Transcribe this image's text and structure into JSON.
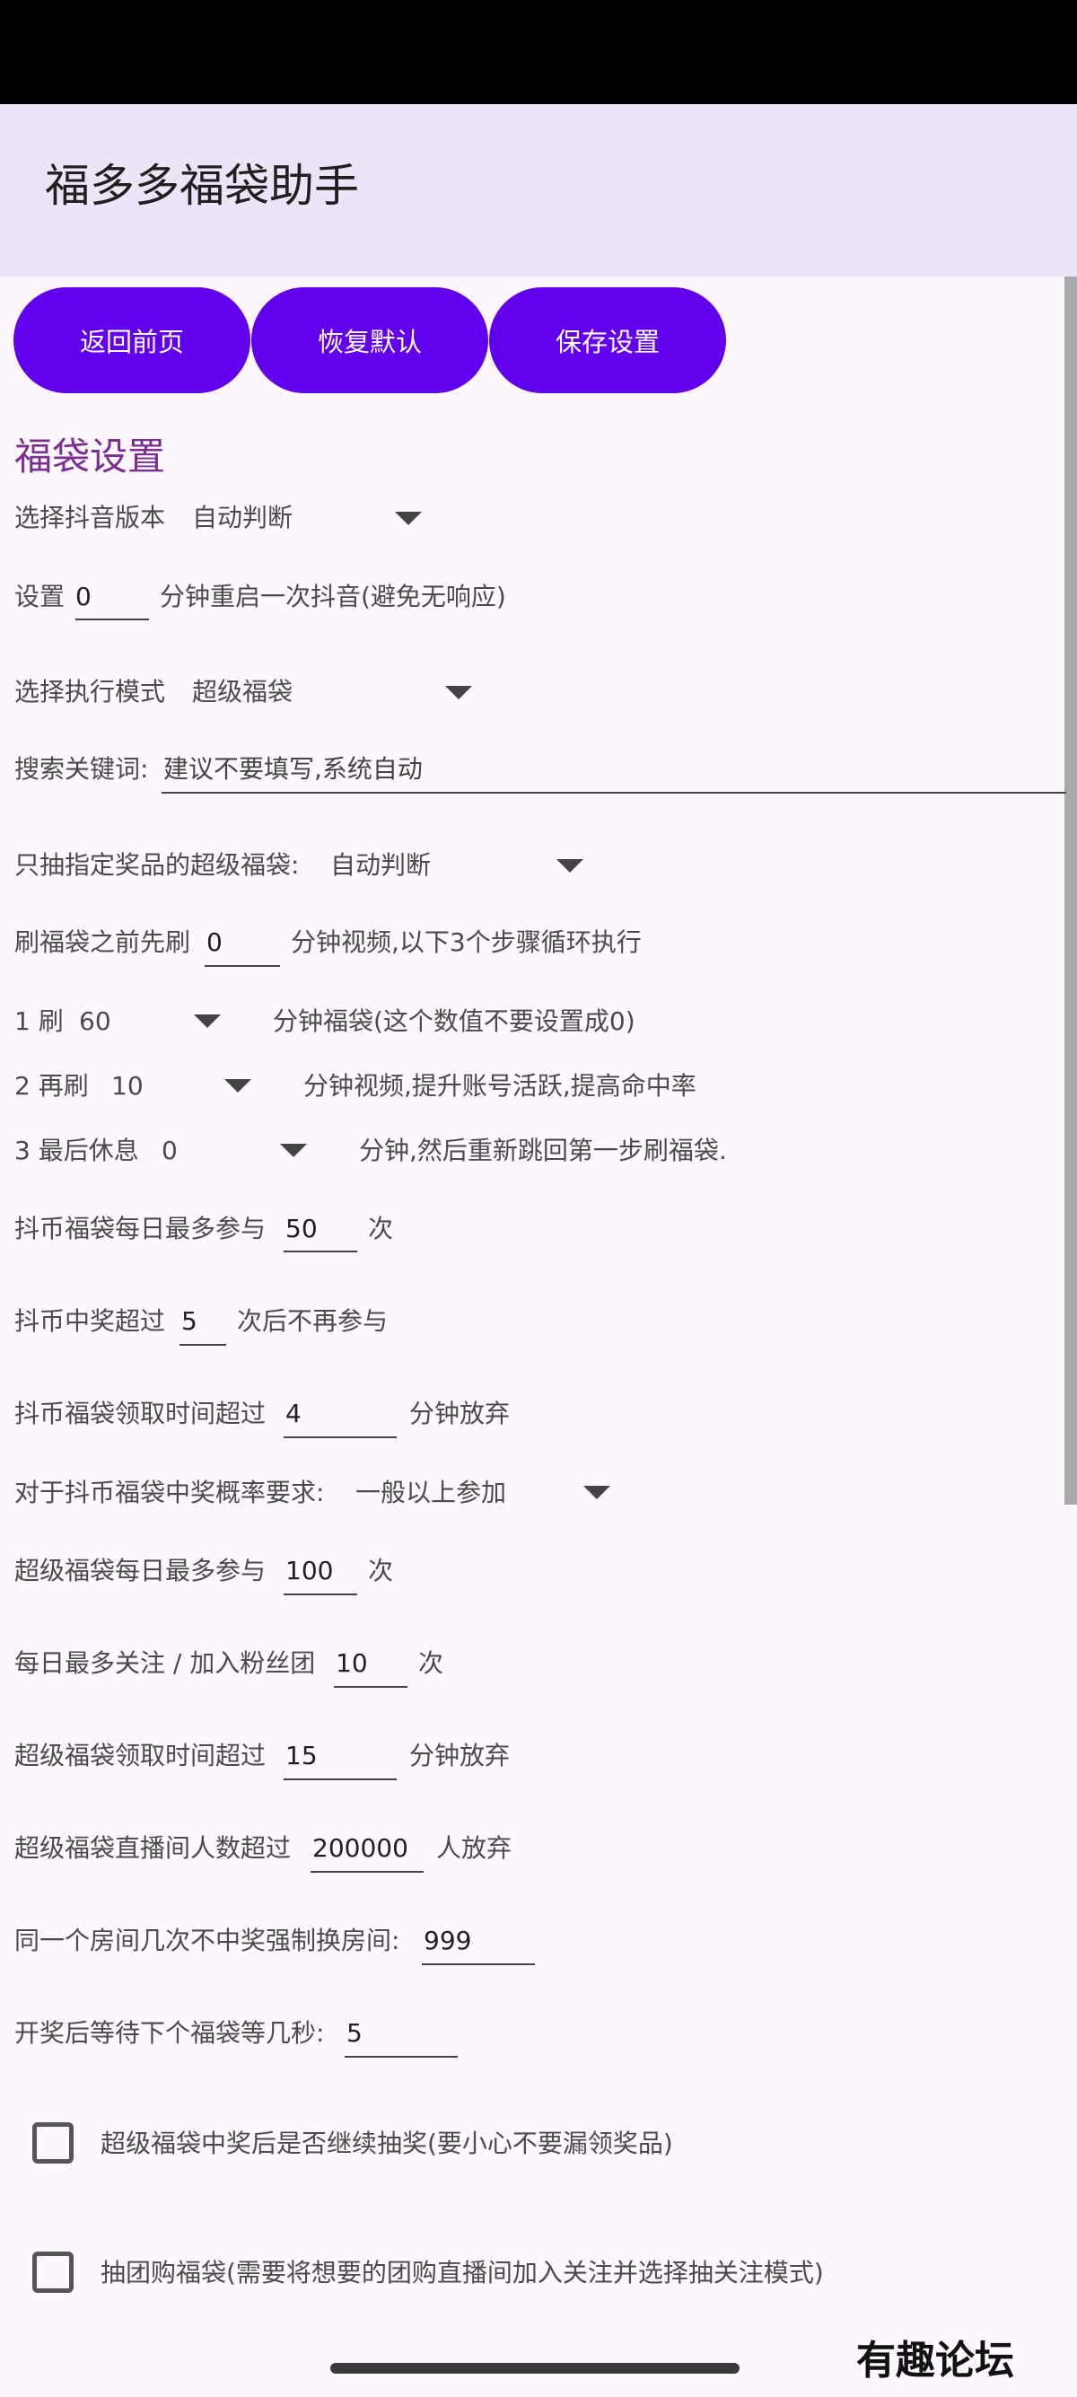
{
  "app": {
    "title": "福多多福袋助手"
  },
  "toolbar": {
    "back_label": "返回前页",
    "reset_label": "恢复默认",
    "save_label": "保存设置"
  },
  "section": {
    "title": "福袋设置"
  },
  "douyin_version": {
    "label": "选择抖音版本",
    "value": "自动判断"
  },
  "restart": {
    "prefix": "设置",
    "value": "0",
    "suffix": "分钟重启一次抖音(避免无响应)"
  },
  "exec_mode": {
    "label": "选择执行模式",
    "value": "超级福袋"
  },
  "keyword": {
    "label": "搜索关键词:",
    "placeholder": "建议不要填写,系统自动"
  },
  "prize_filter": {
    "label": "只抽指定奖品的超级福袋:",
    "value": "自动判断"
  },
  "pre_video": {
    "prefix": "刷福袋之前先刷",
    "value": "0",
    "suffix": "分钟视频,以下3个步骤循环执行"
  },
  "step1": {
    "label": "1 刷",
    "value": "60",
    "suffix": "分钟福袋(这个数值不要设置成0)"
  },
  "step2": {
    "label": "2 再刷",
    "value": "10",
    "suffix": "分钟视频,提升账号活跃,提高命中率"
  },
  "step3": {
    "label": "3 最后休息",
    "value": "0",
    "suffix": "分钟,然后重新跳回第一步刷福袋."
  },
  "coin_daily": {
    "prefix": "抖币福袋每日最多参与",
    "value": "50",
    "suffix": "次"
  },
  "coin_win": {
    "prefix": "抖币中奖超过",
    "value": "5",
    "suffix": "次后不再参与"
  },
  "coin_time": {
    "prefix": "抖币福袋领取时间超过",
    "value": "4",
    "suffix": "分钟放弃"
  },
  "coin_prob": {
    "label": "对于抖币福袋中奖概率要求:",
    "value": "一般以上参加"
  },
  "super_daily": {
    "prefix": "超级福袋每日最多参与",
    "value": "100",
    "suffix": "次"
  },
  "follow_daily": {
    "prefix": "每日最多关注 / 加入粉丝团",
    "value": "10",
    "suffix": "次"
  },
  "super_time": {
    "prefix": "超级福袋领取时间超过",
    "value": "15",
    "suffix": "分钟放弃"
  },
  "super_viewers": {
    "prefix": "超级福袋直播间人数超过",
    "value": "200000",
    "suffix": "人放弃"
  },
  "room_switch": {
    "prefix": "同一个房间几次不中奖强制换房间:",
    "value": "999"
  },
  "wait_next": {
    "prefix": "开奖后等待下个福袋等几秒:",
    "value": "5"
  },
  "continue_after_win": {
    "label": "超级福袋中奖后是否继续抽奖(要小心不要漏领奖品)"
  },
  "group_buy": {
    "label": "抽团购福袋(需要将想要的团购直播间加入关注并选择抽关注模式)"
  },
  "watermark": {
    "text": "有趣论坛"
  }
}
